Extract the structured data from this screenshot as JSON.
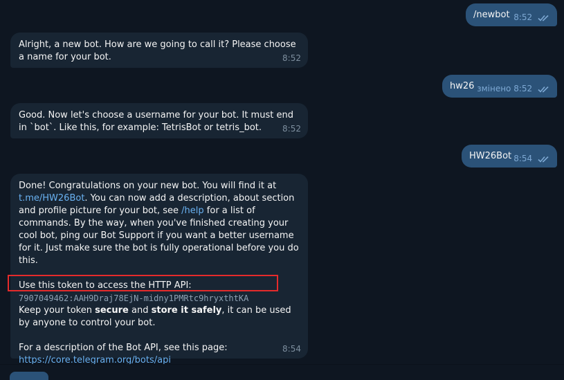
{
  "messages": [
    {
      "text": "/newbot",
      "time": "8:52"
    },
    {
      "text": "Alright, a new bot. How are we going to call it? Please choose a name for your bot.",
      "time": "8:52"
    },
    {
      "text": "hw26",
      "edited": "змінено",
      "time": "8:52"
    },
    {
      "text": "Good. Now let's choose a username for your bot. It must end in `bot`. Like this, for example: TetrisBot or tetris_bot.",
      "time": "8:52"
    },
    {
      "text": "HW26Bot",
      "time": "8:54"
    }
  ],
  "final_message": {
    "intro": "Done! Congratulations on your new bot. You will find it at",
    "bot_link": "t.me/HW26Bot",
    "after_link": ". You can now add a description, about section and profile picture for your bot, see",
    "help_link": "/help",
    "after_help": "for a list of commands. By the way, when you've finished creating your cool bot, ping our Bot Support if you want a better username for it. Just make sure the bot is fully operational before you do this.",
    "token_label": "Use this token to access the HTTP API:",
    "token": "7907049462:AAH9Draj78EjN-midny1PMRtc9hryxthtKA",
    "keep_pre": "Keep your token",
    "keep_secure": "secure",
    "keep_and": "and",
    "keep_store": "store it safely",
    "keep_post": ", it can be used by anyone to control your bot.",
    "api_text": "For a description of the Bot API, see this page:",
    "api_link": "https://core.telegram.org/bots/api",
    "time": "8:54"
  },
  "icons": {
    "read_receipt": "double-check-icon"
  },
  "colors": {
    "background": "#0e1621",
    "incoming_bubble": "#182533",
    "outgoing_bubble": "#2b5278",
    "link": "#6ab2f2",
    "highlight_box": "#e52b2b"
  }
}
